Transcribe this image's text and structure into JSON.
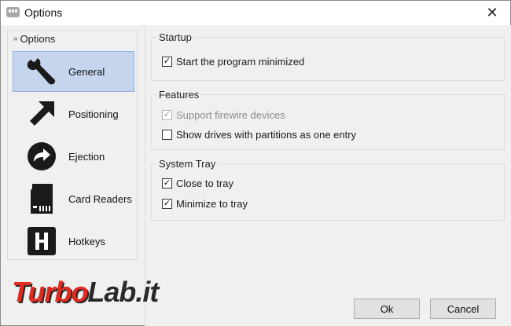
{
  "window": {
    "title": "Options",
    "close_glyph": "✕"
  },
  "nav": {
    "header": "Options",
    "items": [
      {
        "label": "General",
        "icon": "wrench-icon",
        "selected": true
      },
      {
        "label": "Positioning",
        "icon": "arrow-up-left-icon",
        "selected": false
      },
      {
        "label": "Ejection",
        "icon": "eject-arrow-icon",
        "selected": false
      },
      {
        "label": "Card Readers",
        "icon": "sd-card-icon",
        "selected": false
      },
      {
        "label": "Hotkeys",
        "icon": "hotkey-h-icon",
        "selected": false
      }
    ]
  },
  "groups": {
    "startup": {
      "title": "Startup",
      "options": [
        {
          "label": "Start the program minimized",
          "checked": true,
          "enabled": true
        }
      ]
    },
    "features": {
      "title": "Features",
      "options": [
        {
          "label": "Support firewire devices",
          "checked": true,
          "enabled": false
        },
        {
          "label": "Show drives with partitions as one entry",
          "checked": false,
          "enabled": true
        }
      ]
    },
    "tray": {
      "title": "System Tray",
      "options": [
        {
          "label": "Close to tray",
          "checked": true,
          "enabled": true
        },
        {
          "label": "Minimize to tray",
          "checked": true,
          "enabled": true
        }
      ]
    }
  },
  "buttons": {
    "ok": "Ok",
    "cancel": "Cancel"
  },
  "watermark": {
    "part1": "Turbo",
    "part2": "Lab.it"
  },
  "colors": {
    "selected_bg": "#c5d5ee",
    "selected_border": "#8fb0e0",
    "dialog_bg": "#f0f0f0",
    "watermark_red": "#e22b20"
  }
}
